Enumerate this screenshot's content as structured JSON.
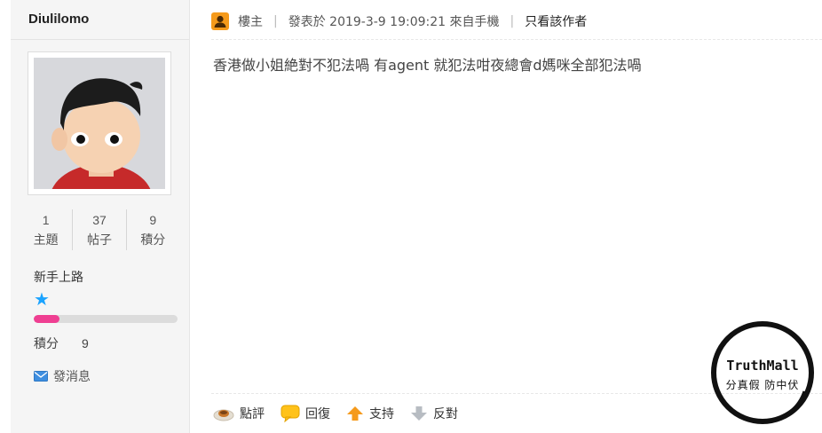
{
  "author": {
    "username": "Diulilomo",
    "stats": [
      {
        "value": "1",
        "label": "主題"
      },
      {
        "value": "37",
        "label": "帖子"
      },
      {
        "value": "9",
        "label": "積分"
      }
    ],
    "rank_title": "新手上路",
    "stars": "★",
    "rank_progress_percent": 18,
    "score_label": "積分",
    "score_value": "9",
    "send_message_label": "發消息"
  },
  "post": {
    "floor_label": "樓主",
    "posted_text": "發表於 2019-3-9 19:09:21 來自手機",
    "author_only_label": "只看該作者",
    "body": "香港做小姐絶對不犯法喎 有agent 就犯法咁夜總會d媽咪全部犯法喎"
  },
  "actions": [
    {
      "label": "點評",
      "icon": "comment-icon"
    },
    {
      "label": "回復",
      "icon": "reply-icon"
    },
    {
      "label": "支持",
      "icon": "thumb-up-arrow-icon"
    },
    {
      "label": "反對",
      "icon": "thumb-down-arrow-icon"
    }
  ],
  "watermark": {
    "line1": "TruthMall",
    "line2": "分真假 防中伏"
  },
  "colors": {
    "accent_blue": "#1aa3ff",
    "progress_pink": "#ef3f92",
    "sidebar_bg": "#f5f5f5",
    "badge_orange": "#f59a1b",
    "support_orange": "#f59a1b",
    "oppose_gray": "#9aa0a6"
  }
}
